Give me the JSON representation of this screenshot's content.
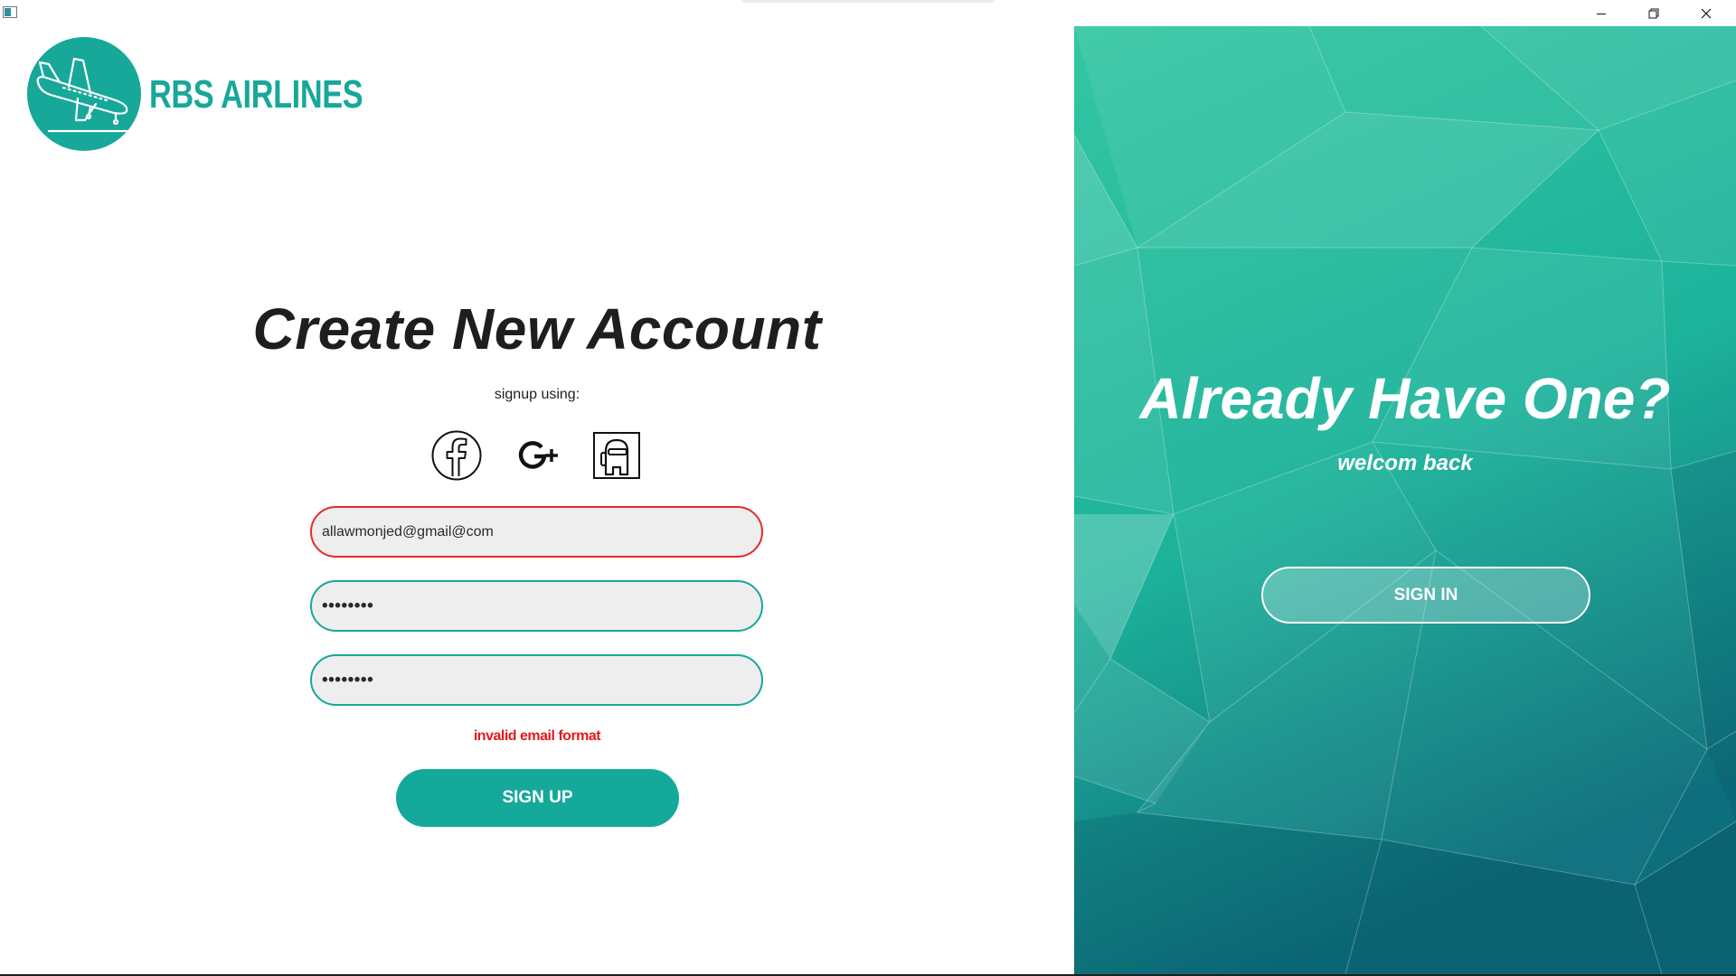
{
  "window": {
    "controls": [
      "minimize-icon",
      "restore-icon",
      "close-icon"
    ]
  },
  "brand": {
    "name": "RBS AIRLINES",
    "color": "#17a89a",
    "logo_icon": "airplane-landing-icon"
  },
  "signup": {
    "heading": "Create New Account",
    "signup_using": "signup using:",
    "social": [
      "facebook-icon",
      "google-plus-icon",
      "among-us-icon"
    ],
    "email_value": "allawmonjed@gmail@com",
    "password_value": "••••••••",
    "confirm_password_value": "••••••••",
    "error_text": "invalid email format",
    "error_color": "#e21a1a",
    "button_label": "SIGN UP"
  },
  "signin_panel": {
    "title": "Already Have One?",
    "subtitle": "welcom back",
    "button_label": "SIGN IN",
    "accent": "#22b79d"
  }
}
